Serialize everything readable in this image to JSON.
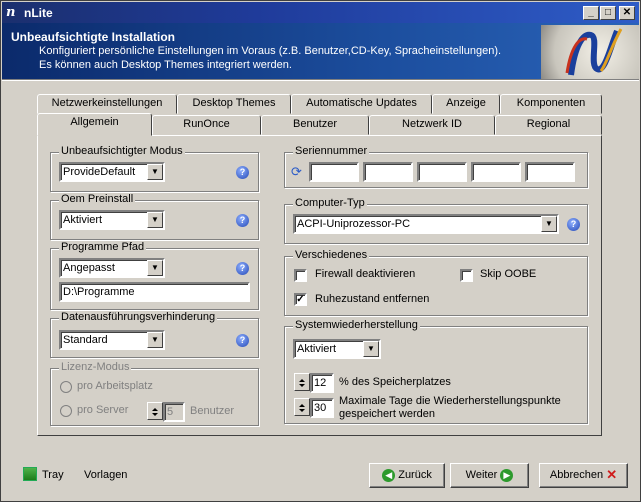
{
  "window": {
    "title": "nLite",
    "icon": "nlite-icon",
    "controls": [
      "minimize",
      "maximize",
      "close"
    ]
  },
  "header": {
    "title": "Unbeaufsichtigte Installation",
    "desc1": "Konfiguriert persönliche Einstellungen im Voraus (z.B. Benutzer,CD-Key, Spracheinstellungen).",
    "desc2": "Es können auch Desktop Themes integriert werden."
  },
  "tabs_top": [
    "Netzwerkeinstellungen",
    "Desktop Themes",
    "Automatische Updates",
    "Anzeige",
    "Komponenten"
  ],
  "tabs_bottom": [
    "Allgemein",
    "RunOnce",
    "Benutzer",
    "Netzwerk ID",
    "Regional"
  ],
  "active_tab": "Allgemein",
  "left": {
    "mode": {
      "title": "Unbeaufsichtigter Modus",
      "value": "ProvideDefault"
    },
    "oem": {
      "title": "Oem Preinstall",
      "value": "Aktiviert"
    },
    "prog": {
      "title": "Programme Pfad",
      "value": "Angepasst",
      "path": "D:\\Programme"
    },
    "dep": {
      "title": "Datenausführungsverhinderung",
      "value": "Standard"
    },
    "lic": {
      "title": "Lizenz-Modus",
      "opt1": "pro Arbeitsplatz",
      "opt2": "pro Server",
      "users": "5",
      "users_label": "Benutzer"
    }
  },
  "right": {
    "serial": {
      "title": "Seriennummer",
      "fields": [
        "",
        "",
        "",
        "",
        ""
      ]
    },
    "comp": {
      "title": "Computer-Typ",
      "value": "ACPI-Uniprozessor-PC"
    },
    "misc": {
      "title": "Verschiedenes",
      "fw": "Firewall deaktivieren",
      "skip": "Skip OOBE",
      "hib": "Ruhezustand entfernen"
    },
    "sys": {
      "title": "Systemwiederherstellung",
      "value": "Aktiviert",
      "pct": "12",
      "pct_label": "% des Speicherplatzes",
      "days": "30",
      "days_label1": "Maximale Tage die Wiederherstellungspunkte",
      "days_label2": "gespeichert werden"
    }
  },
  "footer": {
    "tray": "Tray",
    "templates": "Vorlagen",
    "back": "Zurück",
    "next": "Weiter",
    "cancel": "Abbrechen"
  }
}
